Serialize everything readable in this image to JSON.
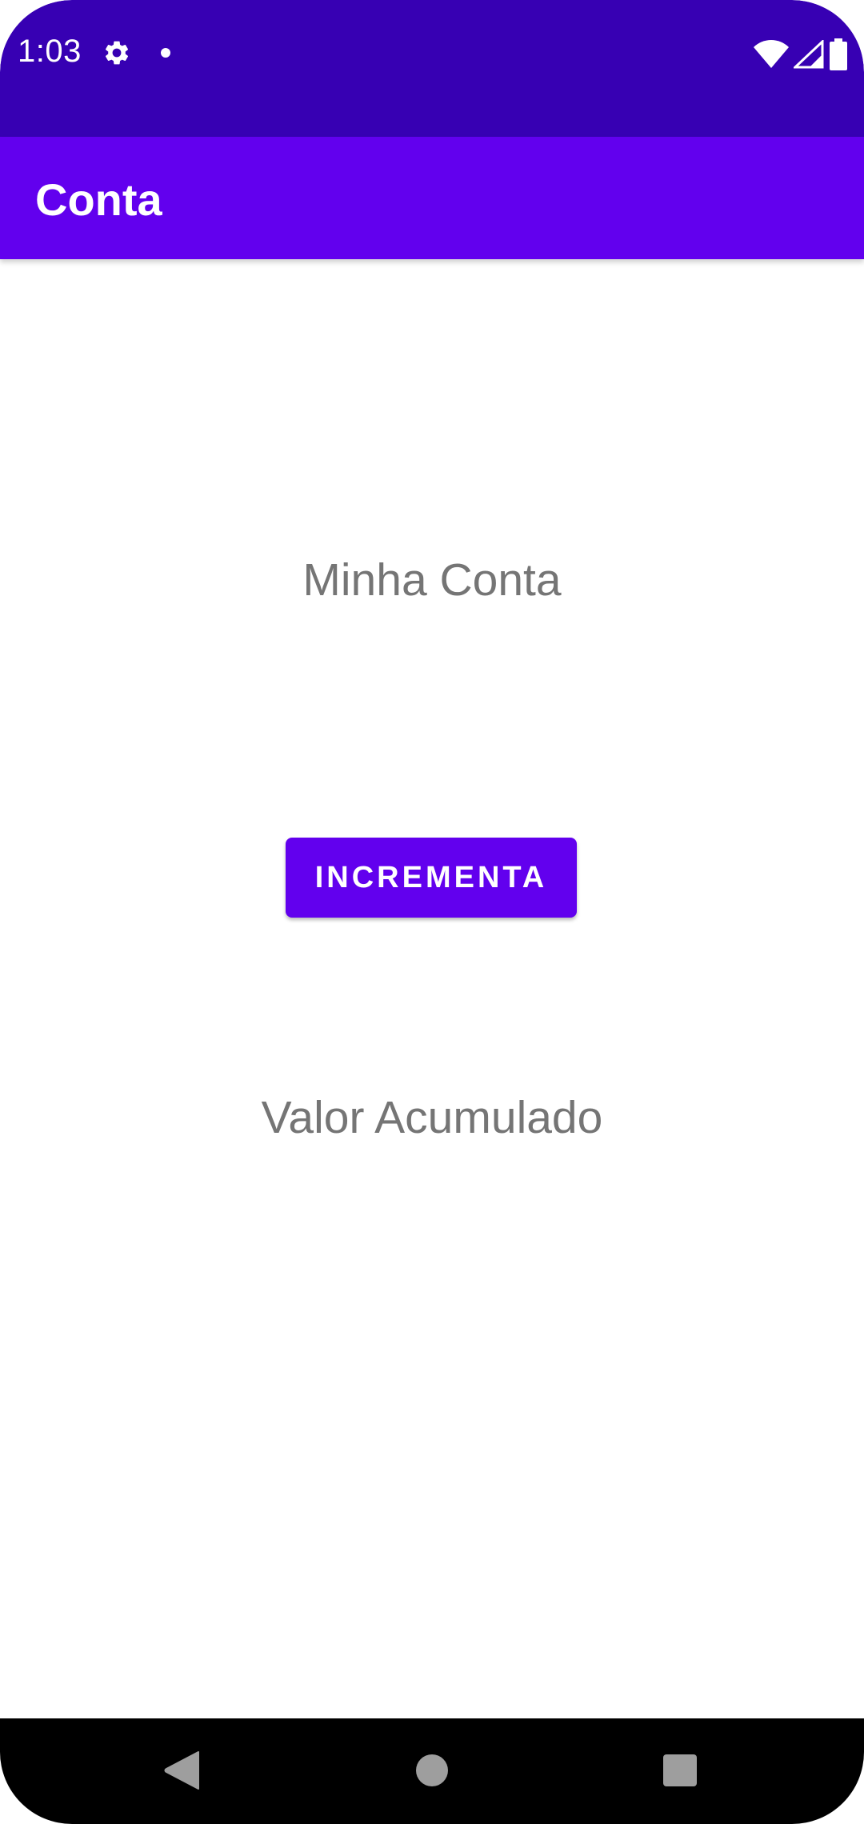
{
  "status_bar": {
    "time": "1:03",
    "icons": [
      "gear-icon",
      "dot-icon",
      "wifi-icon",
      "signal-icon",
      "battery-icon"
    ]
  },
  "app_bar": {
    "title": "Conta"
  },
  "main": {
    "title_text": "Minha Conta",
    "increment_button_label": "INCREMENTA",
    "value_text": "Valor Acumulado"
  },
  "nav_bar": {
    "icons": [
      "back-icon",
      "home-icon",
      "recents-icon"
    ]
  },
  "colors": {
    "status_bar": "#3700b3",
    "primary": "#6200ee",
    "text_secondary": "#757575",
    "nav_bar": "#000000"
  }
}
